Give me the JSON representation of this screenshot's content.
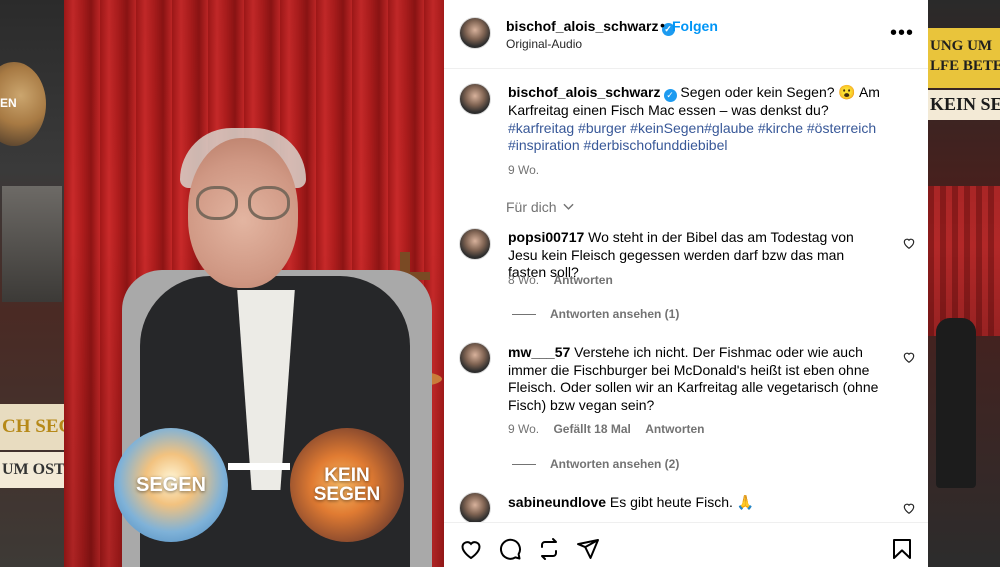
{
  "background": {
    "left_badge_text": "EN",
    "left_band_text": "CH SEG",
    "left_band2_text": "UM OSTE",
    "right_top_text_line1": "UNG UM",
    "right_top_text_line2": "LFE BETEN",
    "right_kein_text": "KEIN SEG"
  },
  "media": {
    "sticker_segen": "SEGEN",
    "sticker_kein_line1": "KEIN",
    "sticker_kein_line2": "SEGEN"
  },
  "header": {
    "username": "bischof_alois_schwarz",
    "dot": "•",
    "follow_label": "Folgen",
    "audio": "Original-Audio",
    "more_label": "•••"
  },
  "caption": {
    "username": "bischof_alois_schwarz",
    "text": "Segen oder kein Segen? 😮 Am Karfreitag einen Fisch Mac essen – was denkst du?",
    "hashtags": "#karfreitag #burger #keinSegen#glaube #kirche #österreich #inspiration #derbischofunddiebibel",
    "time": "9 Wo."
  },
  "for_you": "Für dich",
  "comments": [
    {
      "username": "popsi00717",
      "text": "Wo steht in der Bibel das am Todestag von Jesu kein Fleisch gegessen werden darf bzw das man fasten soll?",
      "time": "8 Wo.",
      "likes": "",
      "reply_label": "Antworten",
      "view_replies": "Antworten ansehen (1)"
    },
    {
      "username": "mw___57",
      "text": "Verstehe ich nicht. Der Fishmac oder wie auch immer die Fischburger bei McDonald's heißt ist eben ohne Fleisch. Oder sollen wir an Karfreitag alle vegetarisch (ohne Fisch) bzw vegan sein?",
      "time": "9 Wo.",
      "likes": "Gefällt 18 Mal",
      "reply_label": "Antworten",
      "view_replies": "Antworten ansehen (2)"
    },
    {
      "username": "sabineundlove",
      "text": "Es gibt heute Fisch. 🙏",
      "time": "",
      "likes": "",
      "reply_label": "",
      "view_replies": ""
    }
  ],
  "actions": {
    "like": "heart-icon",
    "comment": "comment-icon",
    "share": "repost-icon",
    "send": "send-icon",
    "save": "bookmark-icon"
  },
  "colors": {
    "link": "#0095f6",
    "hashtag": "#385898",
    "muted": "#737373",
    "verified": "#1d9bf0"
  }
}
